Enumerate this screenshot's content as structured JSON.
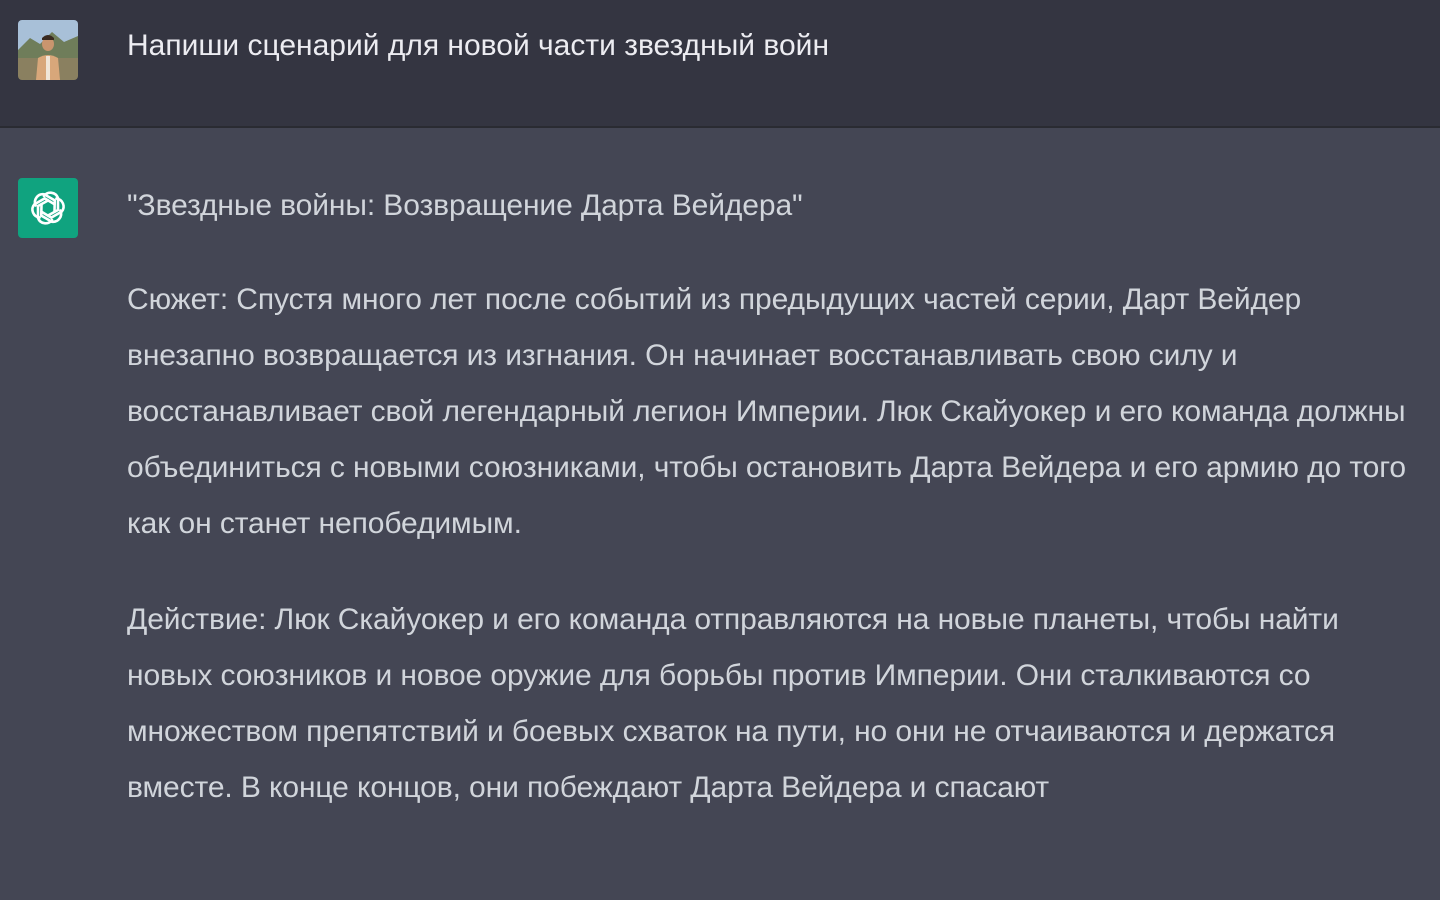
{
  "user_message": {
    "text": "Напиши сценарий для новой части звездный войн"
  },
  "assistant_message": {
    "paragraphs": [
      "\"Звездные войны: Возвращение Дарта Вейдера\"",
      "Сюжет: Спустя много лет после событий из предыдущих частей серии, Дарт Вейдер внезапно возвращается из изгнания. Он начинает восстанавливать свою силу и восстанавливает свой легендарный легион Империи. Люк Скайуокер и его команда должны объединиться с новыми союзниками, чтобы остановить Дарта Вейдера и его армию до того как он станет непобедимым.",
      "Действие: Люк Скайуокер и его команда отправляются на новые планеты, чтобы найти новых союзников и новое оружие для борьбы против Империи. Они сталкиваются со множеством препятствий и боевых схваток на пути, но они не отчаиваются и держатся вместе. В конце концов, они побеждают Дарта Вейдера и спасают"
    ]
  },
  "icons": {
    "user_avatar": "user-photo-avatar",
    "assistant_avatar": "openai-logo-icon"
  },
  "colors": {
    "user_row_bg": "#343541",
    "assistant_row_bg": "#444654",
    "assistant_avatar_bg": "#10a37f",
    "user_text": "#ececf1",
    "assistant_text": "#d1d5db"
  }
}
